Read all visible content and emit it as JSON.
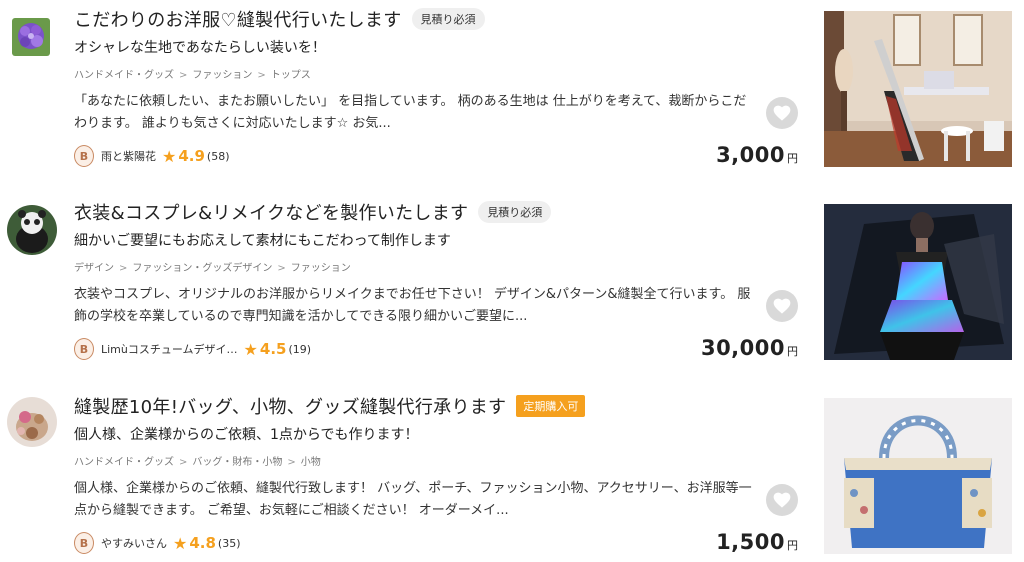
{
  "listings": [
    {
      "title": "こだわりのお洋服♡縫製代行いたします",
      "badge": "見積り必須",
      "subtitle": "オシャレな生地であなたらしい装いを！",
      "breadcrumbs": [
        "ハンドメイド・グッズ",
        "ファッション",
        "トップス"
      ],
      "description": "「あなたに依頼したい、またお願いしたい」 を目指しています。 柄のある生地は 仕上がりを考えて、裁断からこだわります。 誰よりも気さくに対応いたします☆ お気...",
      "rank": "B",
      "seller": "雨と紫陽花",
      "rating": "4.9",
      "reviews": "(58)",
      "price": "3,000",
      "currency": "円"
    },
    {
      "title": "衣装&コスプレ&リメイクなどを製作いたします",
      "badge": "見積り必須",
      "subtitle": "細かいご要望にもお応えして素材にもこだわって制作します",
      "breadcrumbs": [
        "デザイン",
        "ファッション・グッズデザイン",
        "ファッション"
      ],
      "description": "衣装やコスプレ、オリジナルのお洋服からリメイクまでお任せ下さい！ デザイン&パターン&縫製全て行います。 服飾の学校を卒業しているので専門知識を活かしてできる限り細かいご要望に...",
      "rank": "B",
      "seller": "Limùコスチュームデザイ…",
      "rating": "4.5",
      "reviews": "(19)",
      "price": "30,000",
      "currency": "円"
    },
    {
      "title": "縫製歴10年!バッグ、小物、グッズ縫製代行承ります",
      "badge": "定期購入可",
      "subtitle": "個人様、企業様からのご依頼、1点からでも作ります！",
      "breadcrumbs": [
        "ハンドメイド・グッズ",
        "バッグ・財布・小物",
        "小物"
      ],
      "description": "個人様、企業様からのご依頼、縫製代行致します！ バッグ、ポーチ、ファッション小物、アクセサリー、お洋服等一点から縫製できます。 ご希望、お気軽にご相談ください！ オーダーメイ...",
      "rank": "B",
      "seller": "やすみいさん",
      "rating": "4.8",
      "reviews": "(35)",
      "price": "1,500",
      "currency": "円"
    }
  ],
  "colors": {
    "accent_orange": "#f5a01e",
    "heart_bg": "#d9d9d9",
    "rank_bronze": "#c98a63"
  },
  "icons": {
    "favorite": "heart-icon",
    "rating": "star-icon",
    "rank": "rank-badge-icon"
  }
}
